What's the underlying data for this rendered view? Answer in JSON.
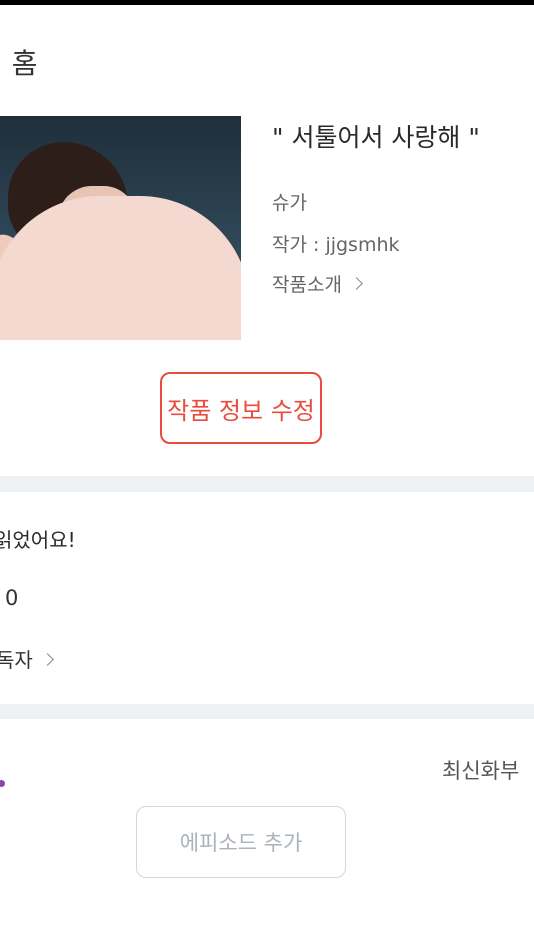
{
  "header": {
    "title": "· 홈"
  },
  "work": {
    "title": "\" 서툴어서 사랑해 \"",
    "character": "슈가",
    "author": "작가 : jjgsmhk",
    "intro_link": "작품소개"
  },
  "actions": {
    "edit_info": "작품 정보 수정"
  },
  "stats": {
    "read_label": "읽었어요!",
    "count": "0",
    "readers_label": "독자"
  },
  "episodes": {
    "sort_label": "최신화부",
    "add_button": "에피소드 추가"
  },
  "colors": {
    "accent_red": "#e74c3c",
    "badge_purple": "#8e44ad",
    "divider": "#eef1f3"
  },
  "icons": {
    "intro_chevron": "chevron-right-icon",
    "readers_chevron": "chevron-right-icon"
  }
}
